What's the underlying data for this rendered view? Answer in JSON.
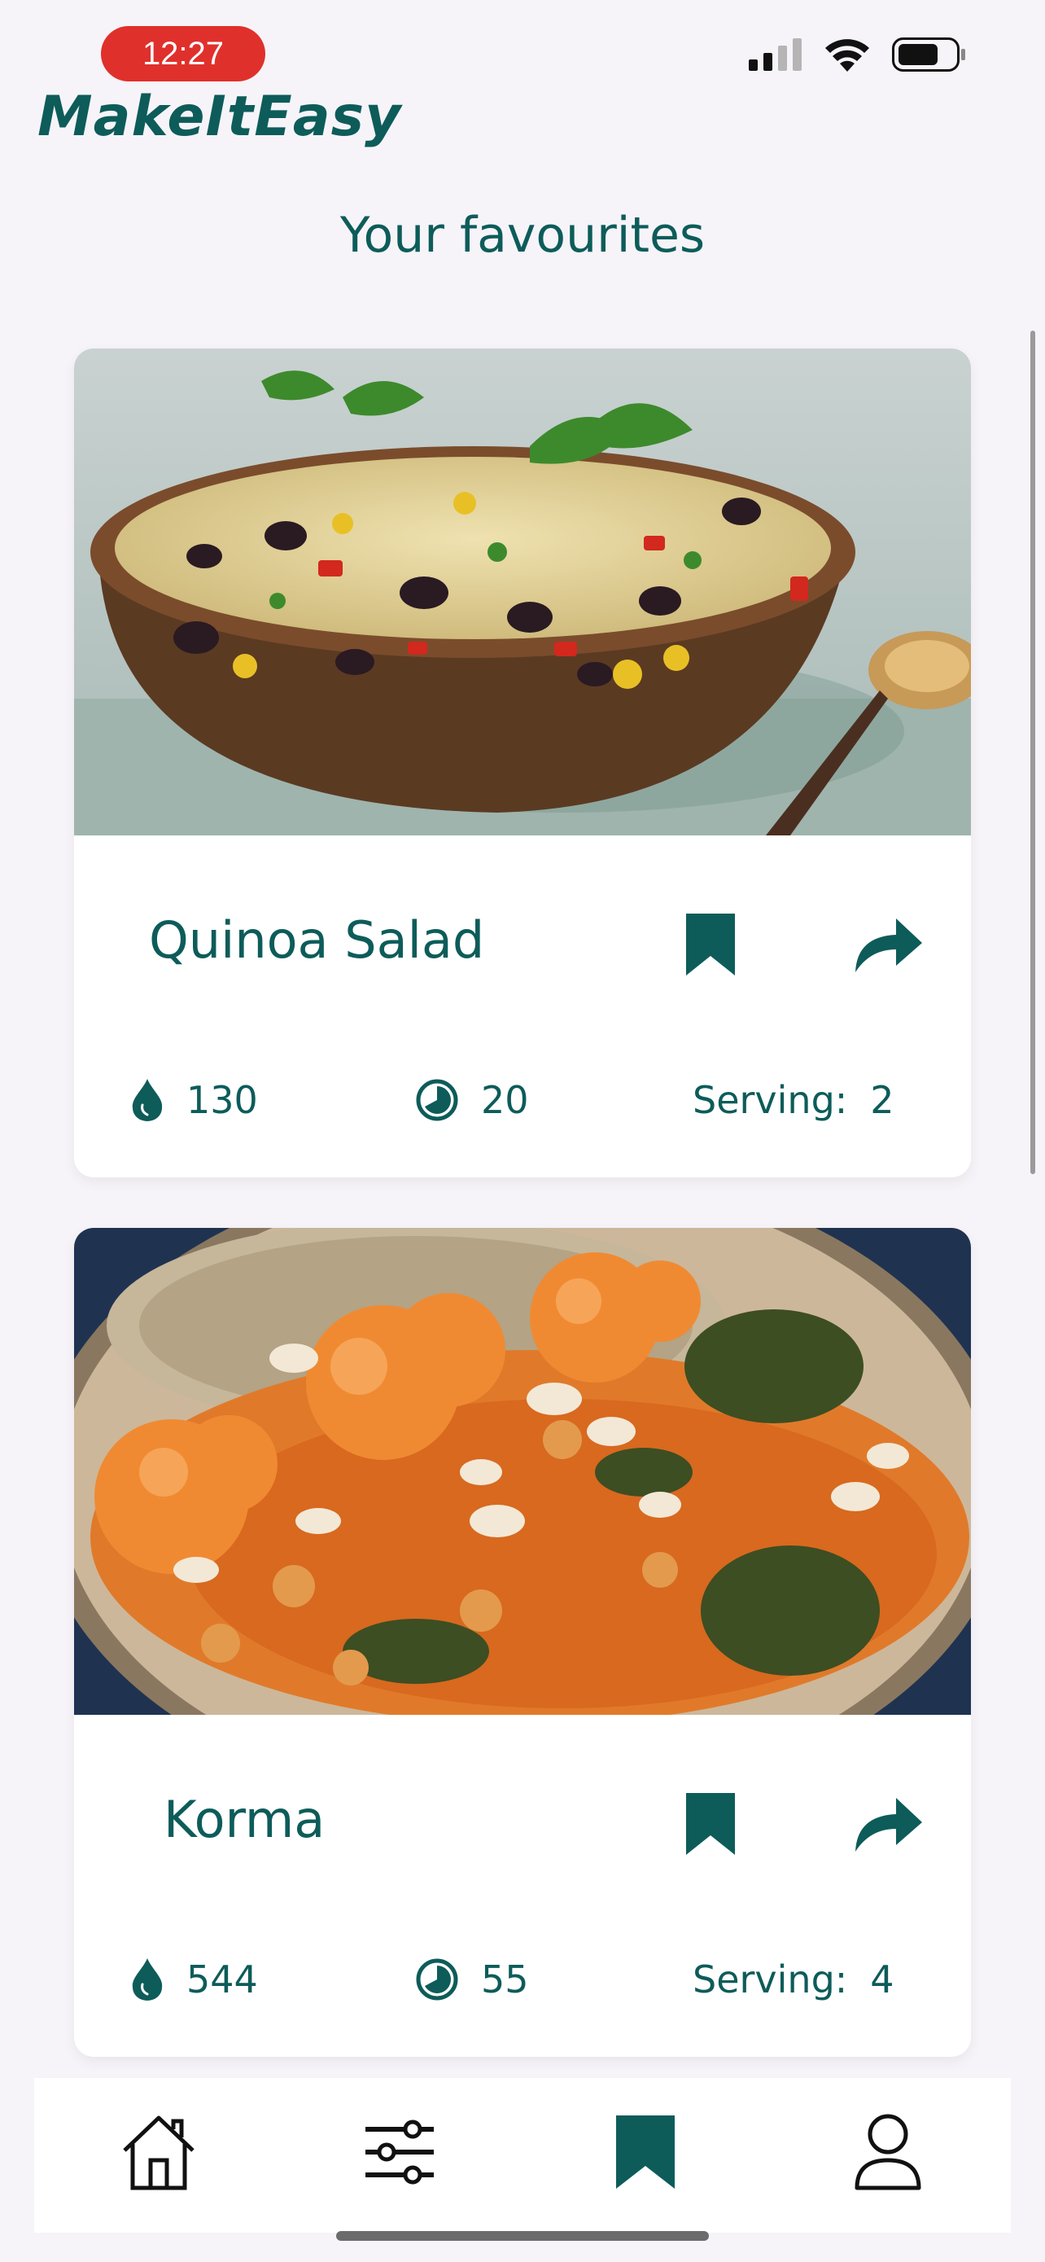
{
  "status": {
    "time": "12:27"
  },
  "app": {
    "logo": "MakeItEasy",
    "page_title": "Your favourites"
  },
  "recipes": [
    {
      "name": "Quinoa Salad",
      "calories": "130",
      "time": "20",
      "serving_label": "Serving:",
      "serving": "2"
    },
    {
      "name": "Korma",
      "calories": "544",
      "time": "55",
      "serving_label": "Serving:",
      "serving": "4"
    }
  ],
  "tabs": [
    {
      "name": "home",
      "icon": "home-icon",
      "active": false
    },
    {
      "name": "filters",
      "icon": "sliders-icon",
      "active": false
    },
    {
      "name": "favourites",
      "icon": "bookmark-icon",
      "active": true
    },
    {
      "name": "profile",
      "icon": "user-icon",
      "active": false
    }
  ],
  "colors": {
    "accent": "#0d5c5a",
    "background": "#f6f4f9",
    "status_pill": "#e0302c"
  }
}
